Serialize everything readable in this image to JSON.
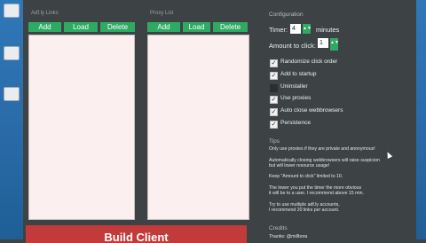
{
  "left_panel": {
    "title": "Adf.ly Links",
    "buttons": [
      "Add",
      "Load",
      "Delete"
    ]
  },
  "middle_panel": {
    "title": "Proxy List",
    "buttons": [
      "Add",
      "Load",
      "Delete"
    ]
  },
  "configuration": {
    "title": "Configuration",
    "timer_label": "Timer:",
    "timer_value": "4",
    "timer_unit": "minutes",
    "amount_label": "Amount to click:",
    "amount_value": "1",
    "options": [
      {
        "label": "Randomize click order",
        "checked": true
      },
      {
        "label": "Add to startup",
        "checked": true
      },
      {
        "label": "Uninstaller",
        "checked": false
      },
      {
        "label": "Use proxies",
        "checked": true
      },
      {
        "label": "Auto close webbrowsers",
        "checked": true
      },
      {
        "label": "Persistence",
        "checked": true
      }
    ]
  },
  "tips": {
    "title": "Tips",
    "lines": [
      "Only use proxies if they are private and anonymous!",
      "",
      "Automatically closing webbrowsers will raise suspicion",
      "but will lower resource usage!",
      "",
      "Keep \"Amount to click\" limited to 10.",
      "",
      "The lower you put the timer the more obvious",
      "it will be to a user. I recommend above 15 min.",
      "",
      "Try to use multiple adf.ly accounts,",
      "I recommend 20 links per account."
    ]
  },
  "credits": {
    "title": "Credits",
    "text": "Thanks: @millbora"
  },
  "build_button": {
    "label": "Build Client"
  },
  "colors": {
    "accent_green": "#2eaa63",
    "build_red": "#c33a3a",
    "background": "#3d4345",
    "listbox": "#fcefef"
  }
}
